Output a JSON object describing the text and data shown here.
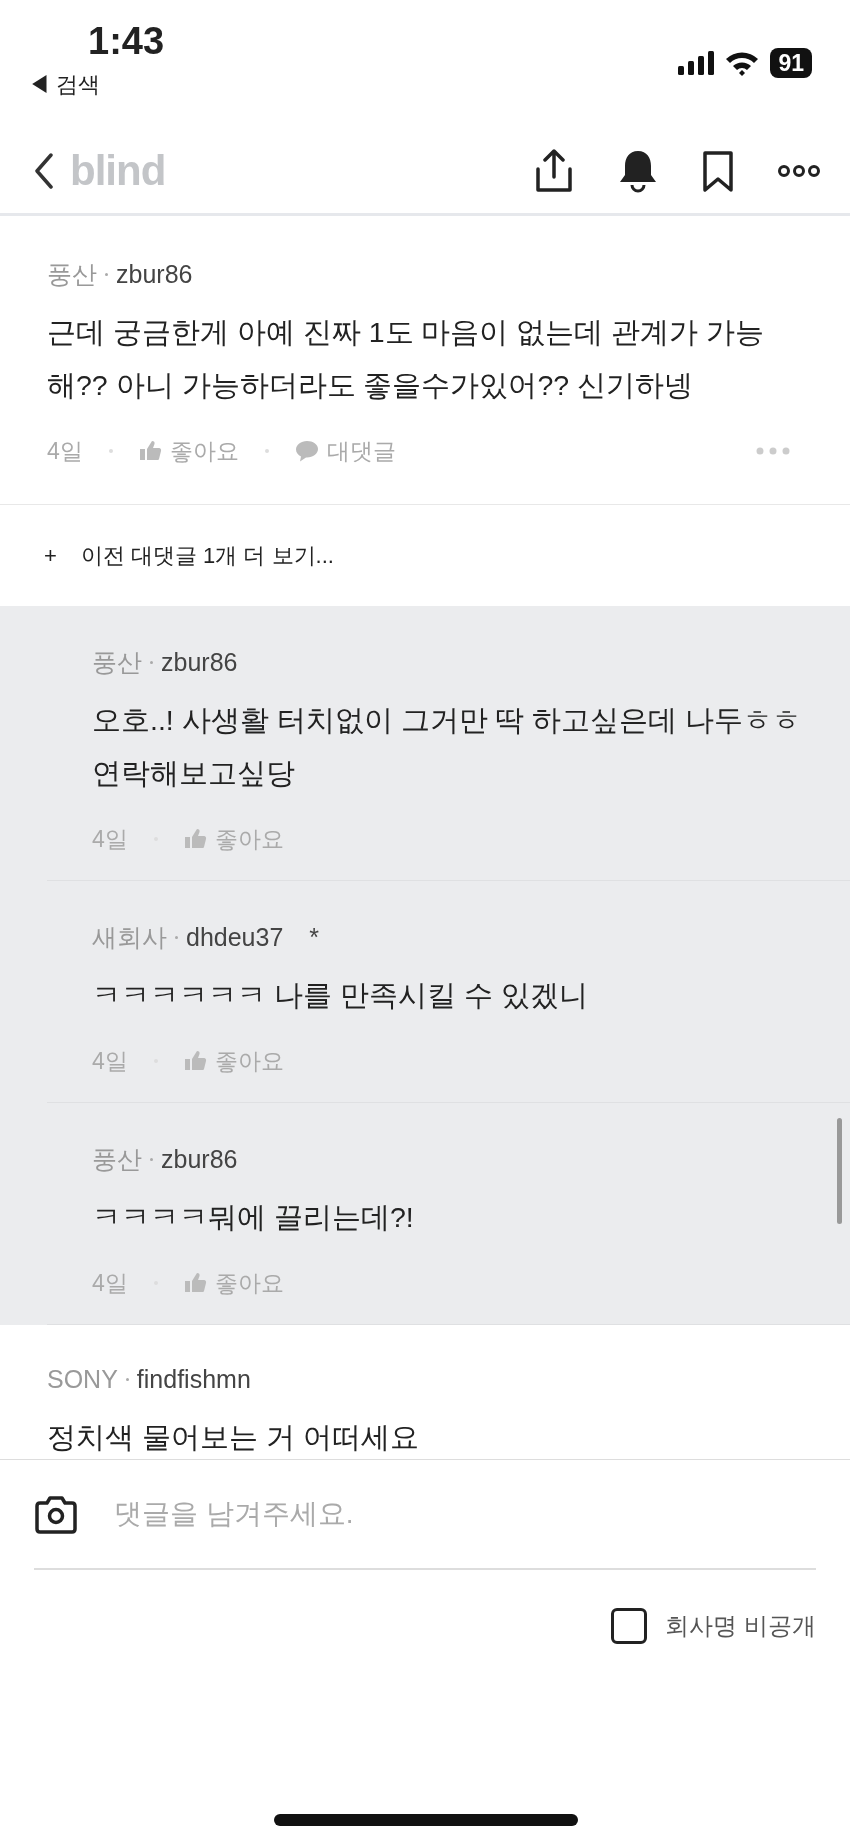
{
  "status_bar": {
    "time": "1:43",
    "back_label": "◀ 검색",
    "battery": "91"
  },
  "nav": {
    "logo": "blind"
  },
  "comments": [
    {
      "company": "풍산",
      "author": "zbur86",
      "text": "근데 궁금한게 아예 진짜 1도 마음이 없는데 관계가 가능해?? 아니 가능하더라도 좋을수가있어?? 신기하넹",
      "date": "4일",
      "like_label": "좋아요",
      "reply_label": "대댓글"
    }
  ],
  "more_replies": {
    "icon": "+",
    "label": "이전 대댓글 1개 더 보기..."
  },
  "replies": [
    {
      "company": "풍산",
      "author": "zbur86",
      "text": "오호..! 사생활 터치없이 그거만 딱 하고싶은데 나두ㅎㅎ 연락해보고싶당",
      "date": "4일",
      "like_label": "좋아요"
    },
    {
      "company": "새회사",
      "author": "dhdeu37",
      "mark": "*",
      "text": "ㅋㅋㅋㅋㅋㅋ 나를 만족시킬 수 있겠니",
      "date": "4일",
      "like_label": "좋아요"
    },
    {
      "company": "풍산",
      "author": "zbur86",
      "text": "ㅋㅋㅋㅋ뭐에 끌리는데?!",
      "date": "4일",
      "like_label": "좋아요"
    }
  ],
  "next_comment": {
    "company": "SONY",
    "author": "findfishmn",
    "text": "정치색 물어보는 거 어떠세요"
  },
  "composer": {
    "placeholder": "댓글을 남겨주세요.",
    "hide_company": {
      "label": "회사명 비공개",
      "checked": false
    }
  }
}
